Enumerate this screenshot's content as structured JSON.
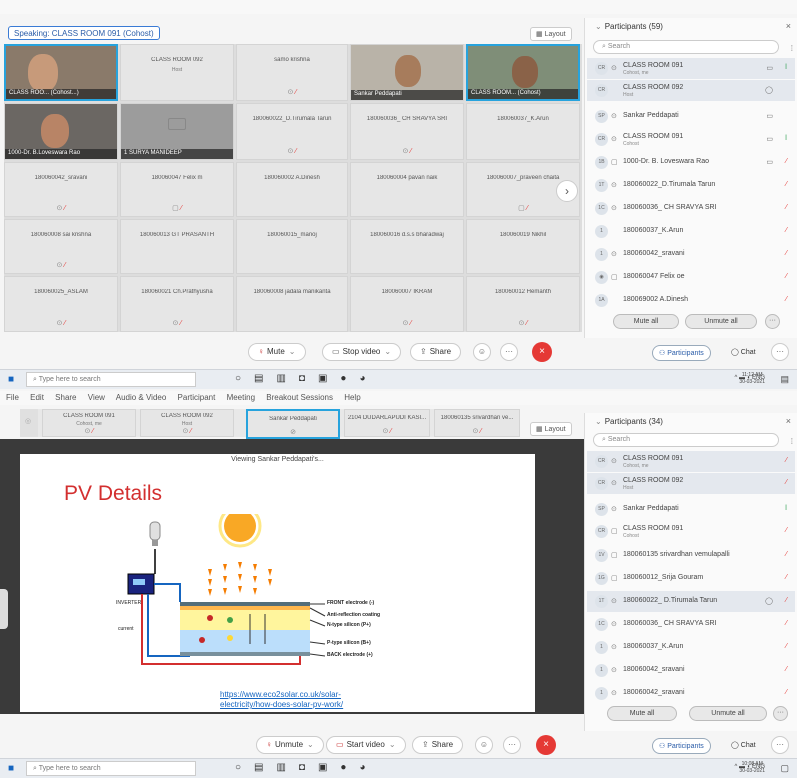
{
  "top": {
    "speaking_label": "Speaking: CLASS ROOM 091 (Cohost)",
    "layout_label": "Layout",
    "tiles_row1": [
      {
        "name": "CLASS ROO... (Cohost...)",
        "video": true
      },
      {
        "name": "CLASS ROOM 092",
        "sub": "Host"
      },
      {
        "name": "samo krishna",
        "sub": ""
      },
      {
        "name": "Sankar Peddapati",
        "video": true
      },
      {
        "name": "CLASS ROOM... (Cohost)",
        "video": true
      }
    ],
    "tiles_row2": [
      {
        "name": "1000-Dr. B.Loveswara Rao",
        "video": true
      },
      {
        "name": "1 SURYA MANIDEEP",
        "camoff": true
      },
      {
        "name": "180060022_D.Tirumala Tarun"
      },
      {
        "name": "180060036_ CH SRAVYA SRI"
      },
      {
        "name": "180060037_K.Arun"
      }
    ],
    "tiles_row3": [
      {
        "name": "180060042_sravani"
      },
      {
        "name": "180060047 Felix m"
      },
      {
        "name": "180060002 A.Dinesh"
      },
      {
        "name": "180060004 pavan naik"
      },
      {
        "name": "180060007_praveen chaita"
      }
    ],
    "tiles_row4": [
      {
        "name": "180060008 sai krishna"
      },
      {
        "name": "180060013 GT PRASANTH"
      },
      {
        "name": "180060015_manoj"
      },
      {
        "name": "180060016 d.s.s bharadwaj"
      },
      {
        "name": "180060019 Nikhil"
      }
    ],
    "tiles_row5": [
      {
        "name": "180060025_ASLAM"
      },
      {
        "name": "180060021 Ch.Prathyusha"
      },
      {
        "name": "180060008 jadala manikanta"
      },
      {
        "name": "180060007 IKRAM"
      },
      {
        "name": "180060012 Hemanth"
      }
    ],
    "next_arrow": "›",
    "participants_title": "Participants (59)",
    "search_placeholder": "Search",
    "participants": [
      {
        "initials": "CR",
        "name": "CLASS ROOM 091",
        "sub": "Cohost, me"
      },
      {
        "initials": "CR",
        "name": "CLASS ROOM 092",
        "sub": "Host"
      },
      {
        "initials": "SP",
        "name": "Sankar Peddapati",
        "sub": ""
      },
      {
        "initials": "CR",
        "name": "CLASS ROOM 091",
        "sub": "Cohost"
      },
      {
        "initials": "1B",
        "name": "1000-Dr. B. Loveswara Rao",
        "sub": ""
      },
      {
        "initials": "1T",
        "name": "180060022_D.Tirumala Tarun",
        "sub": ""
      },
      {
        "initials": "1C",
        "name": "180060036_ CH SRAVYA SRI",
        "sub": ""
      },
      {
        "initials": "1",
        "name": "180060037_K.Arun",
        "sub": ""
      },
      {
        "initials": "1",
        "name": "180060042_sravani",
        "sub": ""
      },
      {
        "initials": "",
        "name": "180060047 Felix oe",
        "sub": ""
      },
      {
        "initials": "1A",
        "name": "180069002 A.Dinesh",
        "sub": ""
      }
    ],
    "mute_all": "Mute all",
    "unmute_all": "Unmute all",
    "controls": {
      "mute": "Mute",
      "stop_video": "Stop video",
      "share": "Share",
      "participants": "Participants",
      "chat": "Chat"
    },
    "taskbar": {
      "search": "Type here to search",
      "lang": "ENG",
      "time": "11:12 AM",
      "date": "30-03-2021"
    }
  },
  "bottom": {
    "menus": [
      "File",
      "Edit",
      "Share",
      "View",
      "Audio & Video",
      "Participant",
      "Meeting",
      "Breakout Sessions",
      "Help"
    ],
    "layout_label": "Layout",
    "strip": [
      {
        "name": "CLASS ROOM 091",
        "sub": "Cohost, me"
      },
      {
        "name": "CLASS ROOM 092",
        "sub": "Host"
      },
      {
        "name": "Sankar Peddapati",
        "sub": ""
      },
      {
        "name": "2104 DUDARLAPUDI KASI...",
        "sub": ""
      },
      {
        "name": "180060135 srivardhan ve...",
        "sub": ""
      }
    ],
    "viewing": "Viewing Sankar Peddapati's...",
    "slide_title": "PV Details",
    "slide_link": "https://www.eco2solar.co.uk/solar-electricity/how-does-solar-pv-work/",
    "diagram_labels": {
      "front": "FRONT electrode (-)",
      "anti": "Anti-reflection coating",
      "ntype": "N-type silicon (P+)",
      "ptype": "P-type silicon (B+)",
      "back": "BACK electrode (+)",
      "inverter": "INVERTER",
      "current": "current"
    },
    "participants_title": "Participants (34)",
    "search_placeholder": "Search",
    "participants": [
      {
        "initials": "CR",
        "name": "CLASS ROOM 091",
        "sub": "Cohost, me"
      },
      {
        "initials": "CR",
        "name": "CLASS ROOM 092",
        "sub": "Host"
      },
      {
        "initials": "SP",
        "name": "Sankar Peddapati",
        "sub": ""
      },
      {
        "initials": "CR",
        "name": "CLASS ROOM 091",
        "sub": "Cohost"
      },
      {
        "initials": "1V",
        "name": "180060135 srivardhan vemulapalli",
        "sub": ""
      },
      {
        "initials": "1G",
        "name": "180060012_Srija Gouram",
        "sub": ""
      },
      {
        "initials": "1T",
        "name": "180060022_ D.Tirumala Tarun",
        "sub": ""
      },
      {
        "initials": "1C",
        "name": "180060036_ CH SRAVYA SRI",
        "sub": ""
      },
      {
        "initials": "1",
        "name": "180060037_K.Arun",
        "sub": ""
      },
      {
        "initials": "1",
        "name": "180060042_sravani",
        "sub": ""
      },
      {
        "initials": "1",
        "name": "180060042_sravani",
        "sub": ""
      }
    ],
    "mute_all": "Mute all",
    "unmute_all": "Unmute all",
    "controls": {
      "unmute": "Unmute",
      "start_video": "Start video",
      "share": "Share",
      "participants": "Participants",
      "chat": "Chat"
    },
    "taskbar": {
      "search": "Type here to search",
      "lang": "ENG",
      "time": "10:08 AM",
      "date": "30-03-2021"
    }
  }
}
